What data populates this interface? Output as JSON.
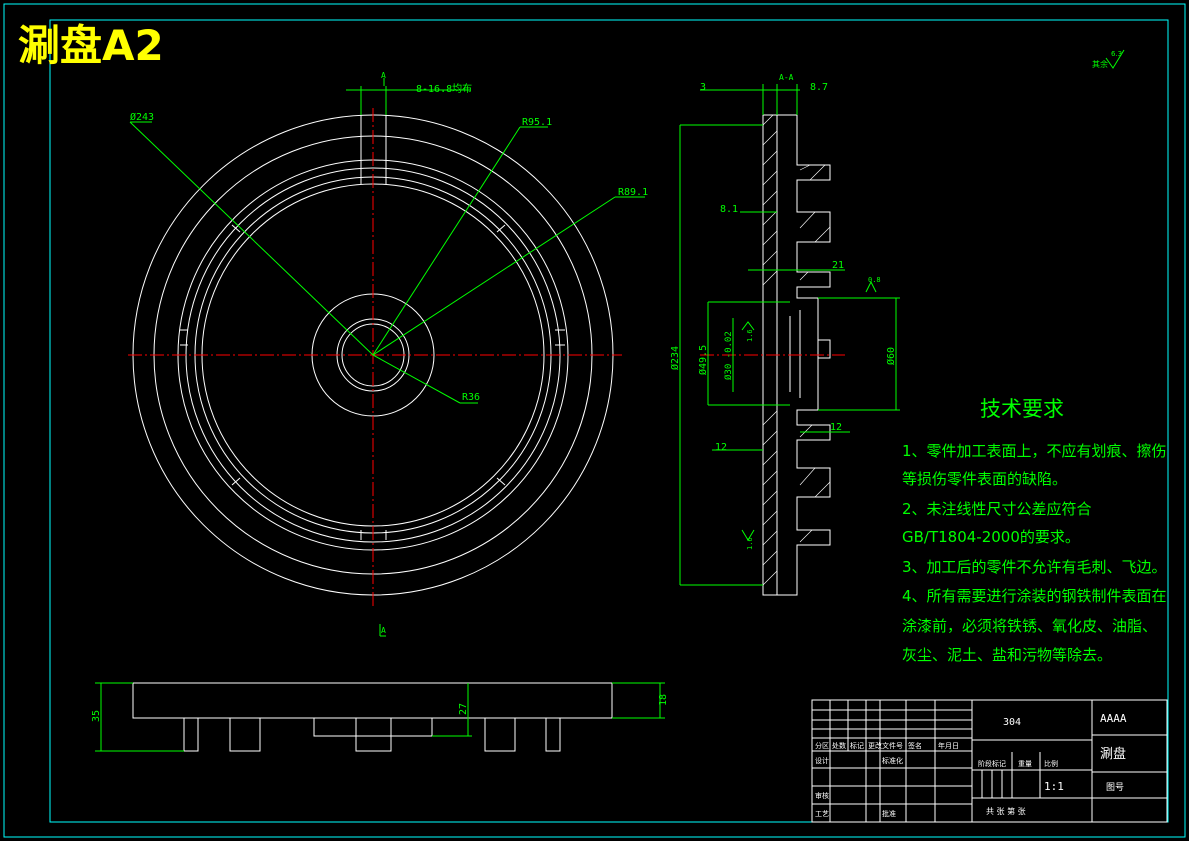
{
  "title": "涮盘A2",
  "roughness": {
    "value": "6.3",
    "label": "其余"
  },
  "front_view": {
    "dims": {
      "d243": "Ø243",
      "r95": "R95.1",
      "r89": "R89.1",
      "r36": "R36",
      "holes": "8-16.8均布"
    },
    "section_marks": {
      "top": "A",
      "bottom": "A"
    }
  },
  "section_view": {
    "label": "A-A",
    "dims": {
      "d3": "3",
      "d8_7": "8.7",
      "d8_1": "8.1",
      "d21": "21",
      "d234": "Ø234",
      "d49_5": "Ø49.5",
      "d30": "Ø30 -0.02",
      "d60": "Ø60",
      "d12a": "12",
      "d12b": "12",
      "r_a": "1.6",
      "r_b": "0.8",
      "r_c": "1.6"
    }
  },
  "bottom_view": {
    "dims": {
      "d35": "35",
      "d27": "27",
      "d18": "18"
    }
  },
  "tech_req": {
    "heading": "技术要求",
    "lines": [
      "1、零件加工表面上，不应有划痕、擦伤",
      "等损伤零件表面的缺陷。",
      "2、未注线性尺寸公差应符合",
      "GB/T1804-2000的要求。",
      "3、加工后的零件不允许有毛刺、飞边。",
      "4、所有需要进行涂装的钢铁制件表面在",
      "涂漆前，必须将铁锈、氧化皮、油脂、",
      "灰尘、泥土、盐和污物等除去。"
    ]
  },
  "title_block": {
    "material": "304",
    "company": "AAAA",
    "part_name": "涮盘",
    "drawing_no": "图号",
    "scale": "1:1",
    "row_labels": [
      "标记",
      "处数",
      "分区",
      "更改文件号",
      "签名",
      "年月日"
    ],
    "labels": {
      "design": "设计",
      "standard": "标准化",
      "stage": "阶段标记",
      "weight": "重量",
      "ratio": "比例",
      "review": "审核",
      "process": "工艺",
      "approve": "批准",
      "sheets": "共  张  第  张"
    }
  },
  "colors": {
    "background": "#000000",
    "outline": "#ffffff",
    "dimension": "#00ff00",
    "centerline": "#ff0000",
    "frame": "#00ffff",
    "text_yellow": "#ffff00"
  }
}
